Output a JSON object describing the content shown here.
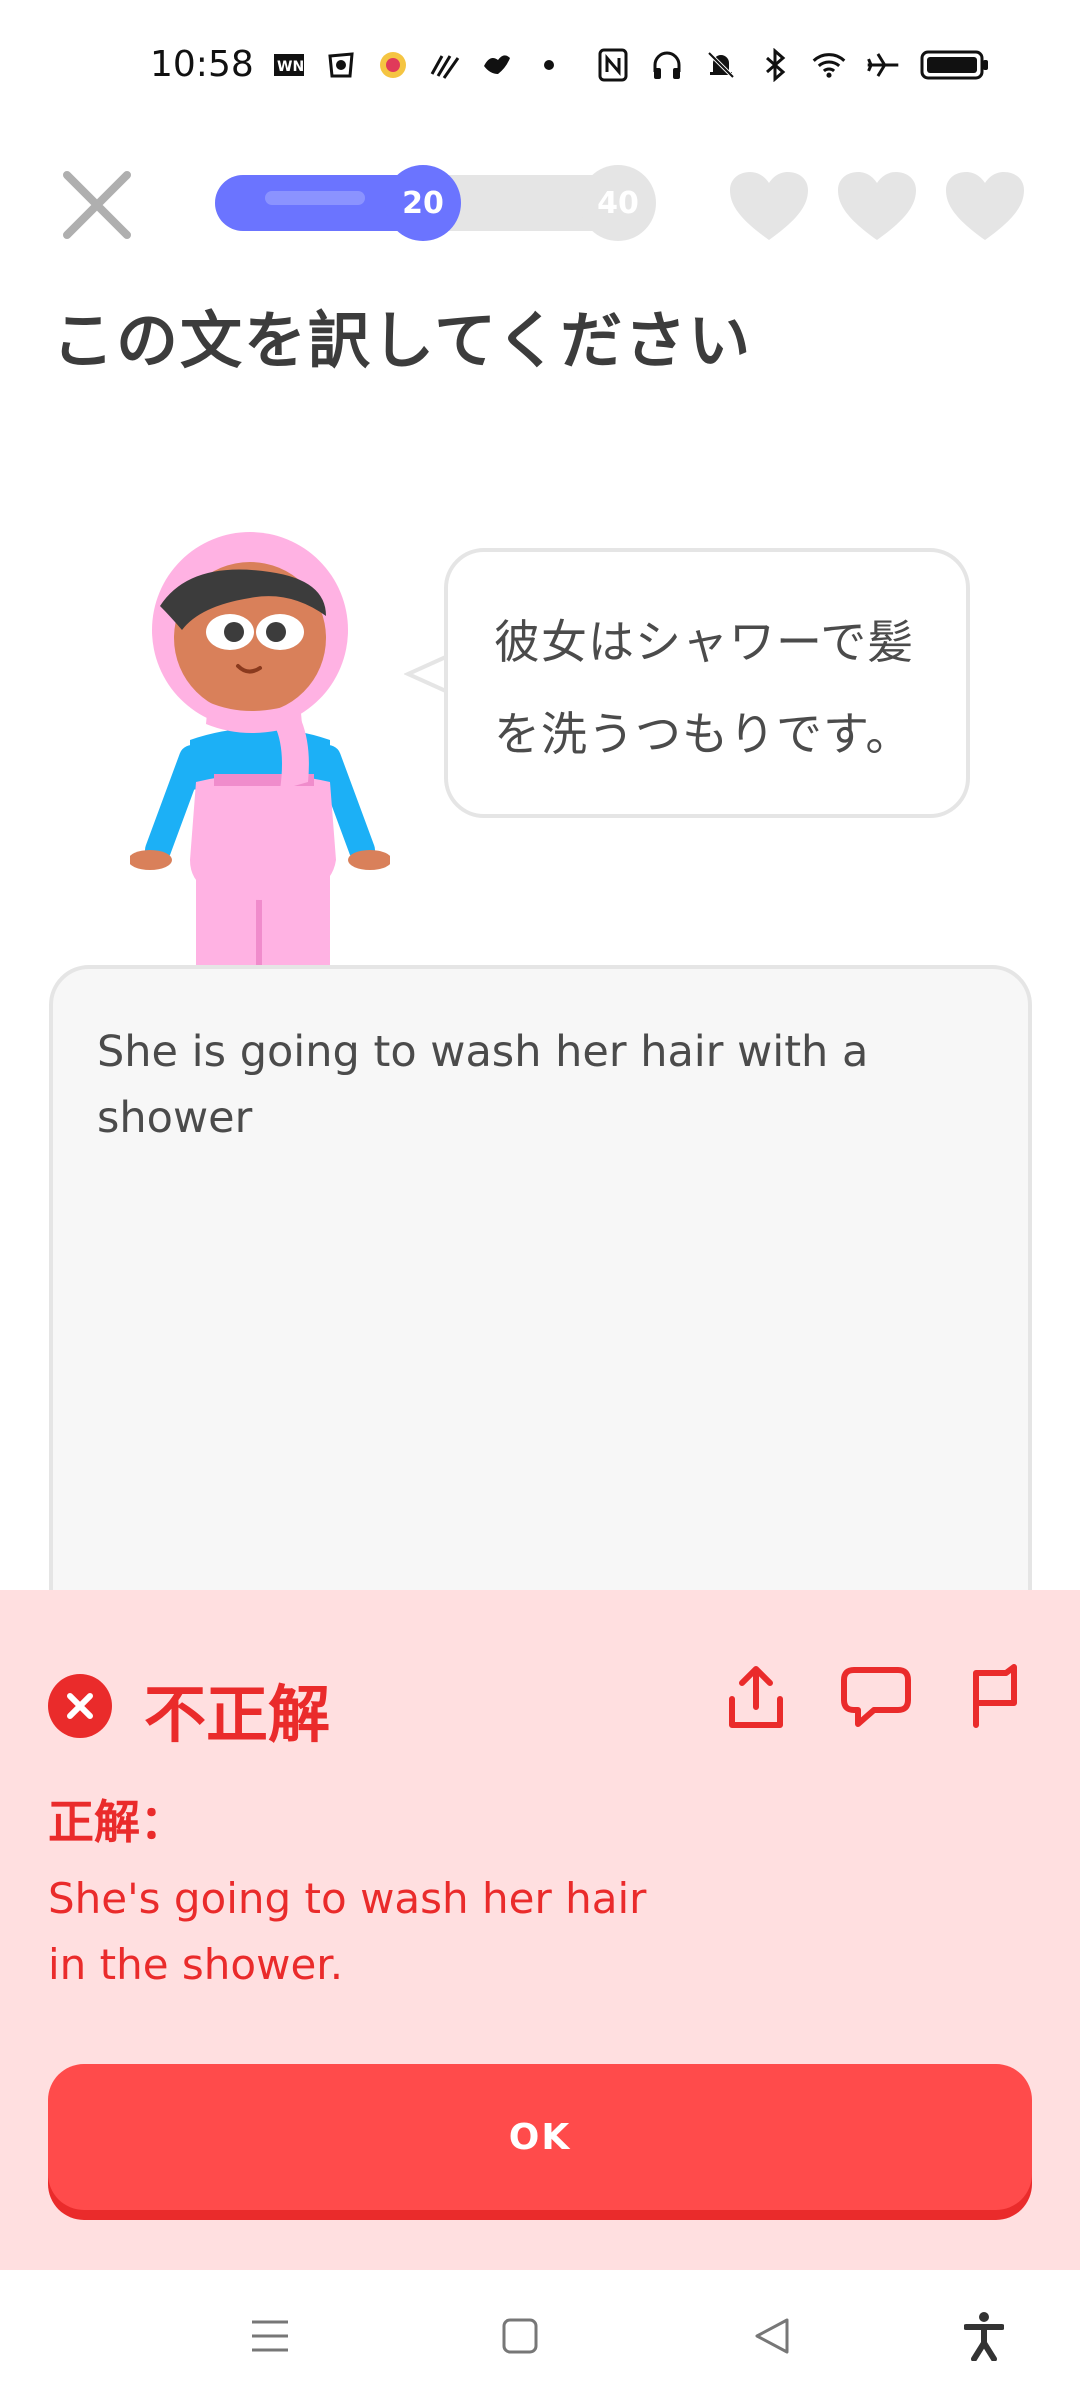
{
  "status_bar": {
    "time": "10:58",
    "left_icons": [
      "nyt-icon",
      "app-icon",
      "badge-icon",
      "wave-icon",
      "bird-icon",
      "dot-icon"
    ],
    "right_icons": [
      "nfc-icon",
      "headphones-icon",
      "bell-off-icon",
      "bluetooth-icon",
      "wifi-icon",
      "airplane-icon",
      "battery-icon"
    ]
  },
  "top_bar": {
    "progress_value": "20",
    "progress_max": "40",
    "progress_fraction": 0.5,
    "hearts": 3
  },
  "instruction": "この文を訳してください",
  "prompt": {
    "line1": "彼女はシャワーで髪",
    "line2": "を洗うつもりです。"
  },
  "answer": {
    "line1": "She is going to wash her hair with a",
    "line2": "shower"
  },
  "feedback": {
    "title": "不正解",
    "correct_label": "正解：",
    "correct_line1": "She's going to wash her hair",
    "correct_line2": "in the shower.",
    "ok_label": "OK"
  },
  "colors": {
    "accent_blue": "#6b74ff",
    "error_red": "#ea2b2b",
    "error_bg": "#ffdfe0",
    "button_red": "#ff4b4b"
  }
}
